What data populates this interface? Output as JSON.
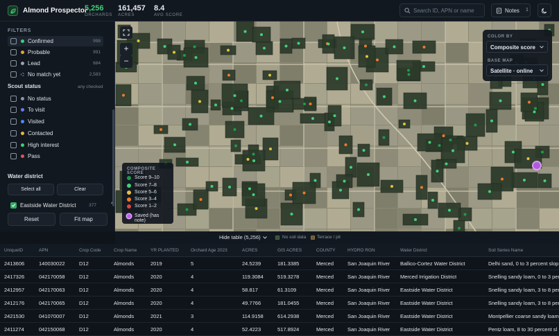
{
  "header": {
    "app_name": "Almond Prospector",
    "stats": [
      {
        "value": "5,256",
        "label": "ORCHARDS",
        "color": "#3ecf78"
      },
      {
        "value": "161,457",
        "label": "ACRES",
        "color": "#f1f3f6"
      },
      {
        "value": "8.4",
        "label": "AVG SCORE",
        "color": "#f1f3f6"
      }
    ],
    "search_placeholder": "Search ID, APN or name",
    "notes_label": "Notes",
    "notes_count": "1"
  },
  "sidebar": {
    "filters_title": "FILTERS",
    "filters": [
      {
        "label": "Confirmed",
        "count": "998",
        "color": "#3ecf78",
        "checked": false,
        "selected": true
      },
      {
        "label": "Probable",
        "count": "991",
        "color": "#e8a23a",
        "checked": false,
        "selected": false
      },
      {
        "label": "Lead",
        "count": "684",
        "color": "#9aa4b0",
        "checked": false,
        "selected": false
      },
      {
        "label": "No match yet",
        "count": "2,583",
        "color": "#5a6472",
        "checked": false,
        "selected": false
      }
    ],
    "scout_title": "Scout status",
    "scout_hint": "any checked",
    "scout": [
      {
        "label": "No status",
        "color": "#8d97a4"
      },
      {
        "label": "To visit",
        "color": "#6c7cf0"
      },
      {
        "label": "Visited",
        "color": "#4a8ef0"
      },
      {
        "label": "Contacted",
        "color": "#e8b93a"
      },
      {
        "label": "High interest",
        "color": "#3ecf78"
      },
      {
        "label": "Pass",
        "color": "#e0555a"
      }
    ],
    "water_title": "Water district",
    "select_all": "Select all",
    "clear": "Clear",
    "district": {
      "label": "Eastside Water District",
      "count": "377"
    },
    "reset": "Reset",
    "fit_map": "Fit map"
  },
  "legend": {
    "title": "COMPOSITE SCORE",
    "items": [
      {
        "label": "Score 9–10",
        "color": "#1f9a4e"
      },
      {
        "label": "Score 7–8",
        "color": "#43d17a"
      },
      {
        "label": "Score 5–6",
        "color": "#e8c23a"
      },
      {
        "label": "Score 3–4",
        "color": "#f07a2a"
      },
      {
        "label": "Score 1–2",
        "color": "#e0453a"
      },
      {
        "label": "Saved (has note)",
        "color": "#c05cf0"
      }
    ]
  },
  "map_panel": {
    "color_by_title": "COLOR BY",
    "color_by_value": "Composite score",
    "base_map_title": "BASE MAP",
    "base_map_value": "Satellite · online"
  },
  "table_bar": {
    "hide_table": "Hide table (5,256)",
    "no_soil": "No soil data",
    "terrace": "Terrace / pit"
  },
  "table": {
    "columns": [
      "UniqueID",
      "APN",
      "Crop Code",
      "Crop Name",
      "YR PLANTED",
      "Orchard Age 2023",
      "ACRES",
      "GIS ACRES",
      "COUNTY",
      "HYDRO RGN",
      "Water District",
      "Soil Series Name"
    ],
    "rows": [
      [
        "2413606",
        "140030022",
        "D12",
        "Almonds",
        "2019",
        "5",
        "24.5239",
        "181.3385",
        "Merced",
        "San Joaquin River",
        "Ballico-Cortez Water District",
        "Delhi sand, 0 to 3 percent slop"
      ],
      [
        "2417326",
        "042170058",
        "D12",
        "Almonds",
        "2020",
        "4",
        "119.3084",
        "519.3278",
        "Merced",
        "San Joaquin River",
        "Merced Irrigation District",
        "Snelling sandy loam, 0 to 3 per"
      ],
      [
        "2412957",
        "042170063",
        "D12",
        "Almonds",
        "2020",
        "4",
        "58.817",
        "61.3109",
        "Merced",
        "San Joaquin River",
        "Eastside Water District",
        "Snelling sandy loam, 3 to 8 per"
      ],
      [
        "2412176",
        "042170065",
        "D12",
        "Almonds",
        "2020",
        "4",
        "49.7766",
        "181.0455",
        "Merced",
        "San Joaquin River",
        "Eastside Water District",
        "Snelling sandy loam, 3 to 8 per"
      ],
      [
        "2421530",
        "041070007",
        "D12",
        "Almonds",
        "2021",
        "3",
        "114.9158",
        "614.2938",
        "Merced",
        "San Joaquin River",
        "Eastside Water District",
        "Montpellier coarse sandy loam"
      ],
      [
        "2411274",
        "042150068",
        "D12",
        "Almonds",
        "2020",
        "4",
        "52.4223",
        "517.8924",
        "Merced",
        "San Joaquin River",
        "Eastside Water District",
        "Pentz loam, 8 to 30 percent sl"
      ]
    ]
  }
}
